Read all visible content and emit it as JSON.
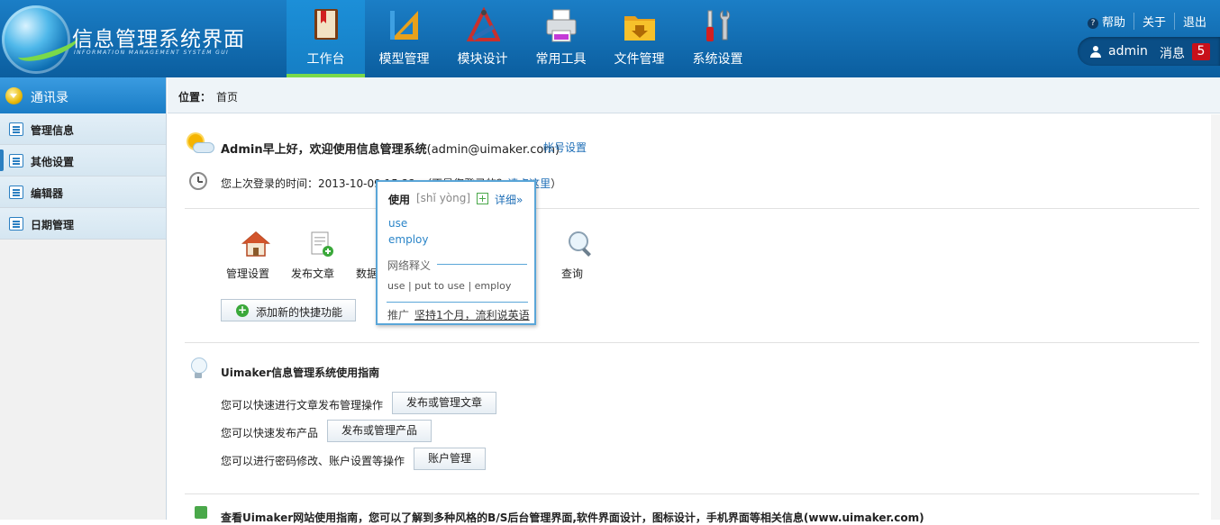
{
  "header": {
    "title": "信息管理系统界面",
    "subtitle": "INFORMATION MANAGEMENT SYSTEM GUI",
    "nav": [
      {
        "label": "工作台",
        "icon": "book-icon"
      },
      {
        "label": "模型管理",
        "icon": "ruler-triangle-icon"
      },
      {
        "label": "模块设计",
        "icon": "drafting-tools-icon"
      },
      {
        "label": "常用工具",
        "icon": "printer-icon"
      },
      {
        "label": "文件管理",
        "icon": "folder-download-icon"
      },
      {
        "label": "系统设置",
        "icon": "wrench-screwdriver-icon"
      }
    ],
    "top_links": {
      "help": "帮助",
      "about": "关于",
      "logout": "退出"
    },
    "user": {
      "name": "admin",
      "messages_label": "消息",
      "messages_count": "5"
    }
  },
  "sidebar": {
    "header": "通讯录",
    "items": [
      {
        "label": "管理信息",
        "icon": "list-icon"
      },
      {
        "label": "其他设置",
        "icon": "chat-icon"
      },
      {
        "label": "编辑器",
        "icon": "edit-icon"
      },
      {
        "label": "日期管理",
        "icon": "calendar-icon"
      }
    ]
  },
  "breadcrumb": {
    "label": "位置：",
    "value": "首页"
  },
  "main": {
    "welcome": {
      "bold": "Admin早上好，欢迎使用信息管理系统",
      "email": "(admin@uimaker.com)",
      "account_link": "帐号设置"
    },
    "last_login": {
      "prefix": "您上次登录的时间：2013-10-09 15:22，（不是您登录的？",
      "link": "请点这里",
      "suffix": "）"
    },
    "shortcuts": [
      {
        "label": "管理设置",
        "icon": "house-icon"
      },
      {
        "label": "发布文章",
        "icon": "document-add-icon"
      },
      {
        "label": "数据统计",
        "icon": "chart-books-icon"
      },
      {
        "label": "查询",
        "icon": "magnifier-icon"
      }
    ],
    "add_shortcut": "添加新的快捷功能",
    "guide": {
      "title": "Uimaker信息管理系统使用指南",
      "rows": [
        {
          "text": "您可以快速进行文章发布管理操作",
          "button": "发布或管理文章"
        },
        {
          "text": "您可以快速发布产品",
          "button": "发布或管理产品"
        },
        {
          "text": "您可以进行密码修改、账户设置等操作",
          "button": "账户管理"
        }
      ]
    },
    "footer": "查看Uimaker网站使用指南，您可以了解到多种风格的B/S后台管理界面,软件界面设计，图标设计，手机界面等相关信息(www.uimaker.com)"
  },
  "dict_popup": {
    "word": "使用",
    "pinyin": "[shǐ yòng]",
    "detail": "详细»",
    "definitions": [
      "use",
      "employ"
    ],
    "net_title": "网络释义",
    "net_values": "use | put to use | employ",
    "ad_label": "推广",
    "ad_link": "坚持1个月，流利说英语"
  }
}
